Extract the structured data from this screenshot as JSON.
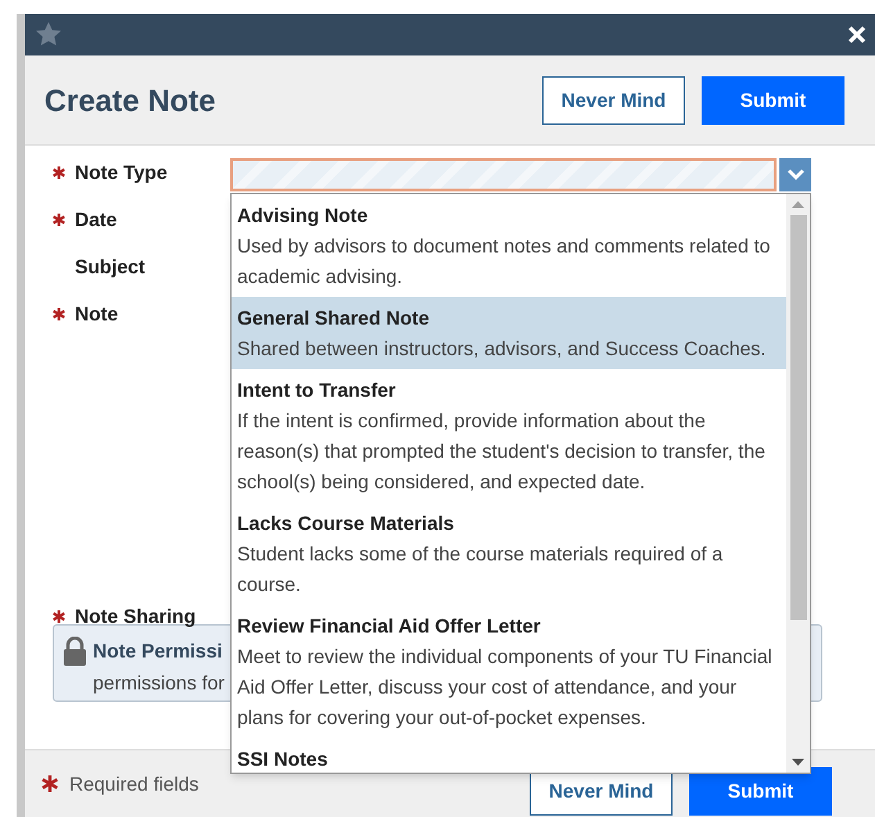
{
  "dialog": {
    "title": "Create Note",
    "header_buttons": [
      {
        "label": "Never Mind",
        "kind": "secondary"
      },
      {
        "label": "Submit",
        "kind": "primary"
      }
    ]
  },
  "form": {
    "fields": [
      {
        "label": "Note Type",
        "required": true
      },
      {
        "label": "Date",
        "required": true
      },
      {
        "label": "Subject",
        "required": false
      },
      {
        "label": "Note",
        "required": true
      },
      {
        "label": "Note Sharing",
        "required": true
      }
    ],
    "permissions_notice": {
      "title": "Note Permissi",
      "text": "permissions for"
    }
  },
  "note_type_dropdown": {
    "options": [
      {
        "title": "Advising Note",
        "description": "Used by advisors to document notes and comments related to academic advising.",
        "selected": false
      },
      {
        "title": "General Shared Note",
        "description": "Shared between instructors, advisors, and Success Coaches.",
        "selected": true
      },
      {
        "title": "Intent to Transfer",
        "description": "If the intent is confirmed, provide information about the reason(s) that prompted the student's decision to transfer, the school(s) being considered, and expected date.",
        "selected": false
      },
      {
        "title": "Lacks Course Materials",
        "description": "Student lacks some of the course materials required of a course.",
        "selected": false
      },
      {
        "title": "Review Financial Aid Offer Letter",
        "description": "Meet to review the individual components of your TU Financial Aid Offer Letter, discuss your cost of attendance, and your plans for covering your out-of-pocket expenses.",
        "selected": false
      },
      {
        "title": "SSI Notes",
        "selected": false
      }
    ]
  },
  "footer": {
    "required_note": "Required fields",
    "buttons": [
      {
        "label": "Never Mind",
        "kind": "secondary"
      },
      {
        "label": "Submit",
        "kind": "primary"
      }
    ]
  }
}
